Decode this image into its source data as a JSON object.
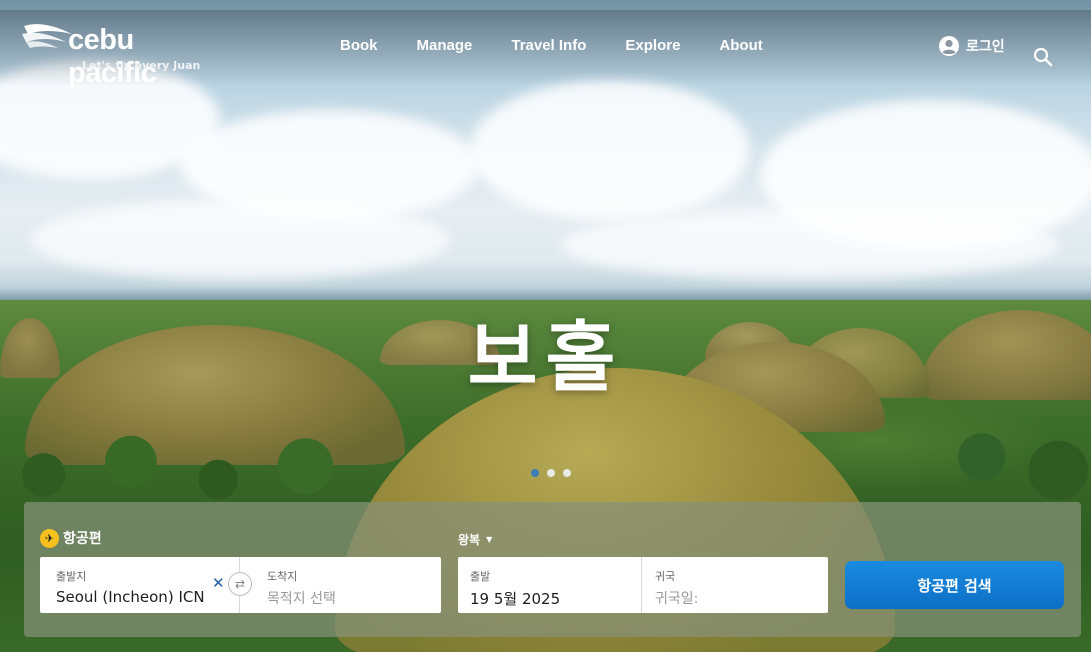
{
  "header": {
    "logo_text": "cebu pacific",
    "tagline": "Let's fly every Juan",
    "nav": [
      {
        "label": "Book",
        "name": "nav-book"
      },
      {
        "label": "Manage",
        "name": "nav-manage"
      },
      {
        "label": "Travel Info",
        "name": "nav-travel-info"
      },
      {
        "label": "Explore",
        "name": "nav-explore"
      },
      {
        "label": "About",
        "name": "nav-about"
      }
    ],
    "login_label": "로그인",
    "icons": {
      "login": "user-circle-icon",
      "search": "search-icon"
    }
  },
  "hero": {
    "title": "보홀",
    "carousel": {
      "count": 3,
      "active_index": 0
    }
  },
  "booking": {
    "tab_label": "항공편",
    "trip_type": "왕복",
    "origin": {
      "label": "출발지",
      "value": "Seoul (Incheon) ICN"
    },
    "destination": {
      "label": "도착지",
      "placeholder": "목적지 선택"
    },
    "depart": {
      "label": "출발",
      "value": "19 5월 2025"
    },
    "return": {
      "label": "귀국",
      "placeholder": "귀국일:"
    },
    "search_label": "항공편 검색",
    "clear_symbol": "✕",
    "icons": {
      "tab": "airplane-icon",
      "swap": "swap-arrows-icon",
      "clear": "close-icon",
      "trip_caret": "caret-down-icon"
    }
  },
  "colors": {
    "accent_blue": "#0c6fc6",
    "tab_yellow": "#f6c11d",
    "dot_active": "#3b7fb8"
  }
}
